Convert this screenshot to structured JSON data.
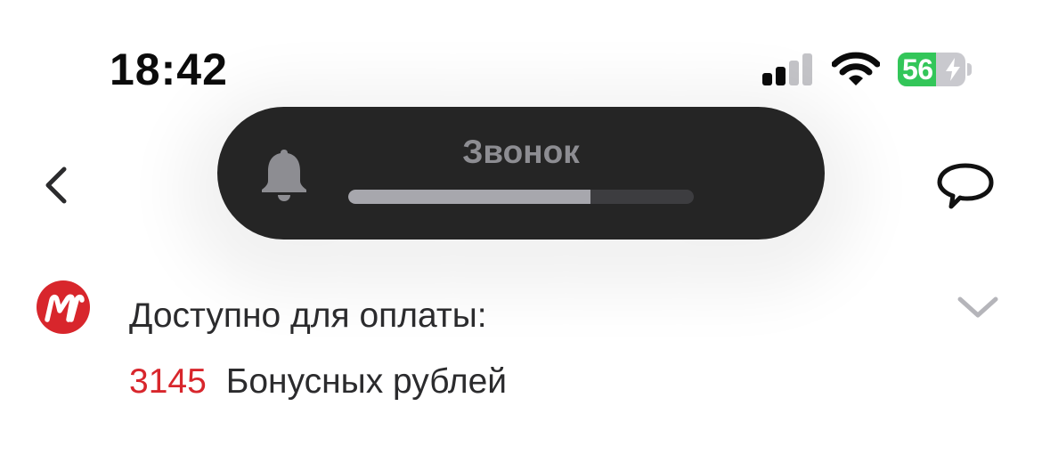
{
  "status_bar": {
    "time": "18:42",
    "signal_bars_active": 2,
    "signal_bars_total": 4,
    "battery_percent": "56",
    "battery_level": 0.56,
    "charging": true,
    "icons": [
      "cellular-signal-icon",
      "wifi-icon",
      "battery-icon",
      "charging-bolt-icon"
    ]
  },
  "nav": {
    "back_icon": "chevron-left-icon",
    "chat_icon": "speech-bubble-icon"
  },
  "volume_hud": {
    "title": "Звонок",
    "icon": "bell-icon",
    "level": 0.7
  },
  "bonus": {
    "logo_icon": "m-video-logo",
    "label": "Доступно для оплаты:",
    "amount": "3145",
    "unit": "Бонусных рублей",
    "expand_icon": "chevron-down-icon"
  },
  "colors": {
    "accent_red": "#d8262c",
    "battery_green": "#33c659",
    "hud_background": "#252525",
    "hud_fill": "#a7a7ad"
  }
}
